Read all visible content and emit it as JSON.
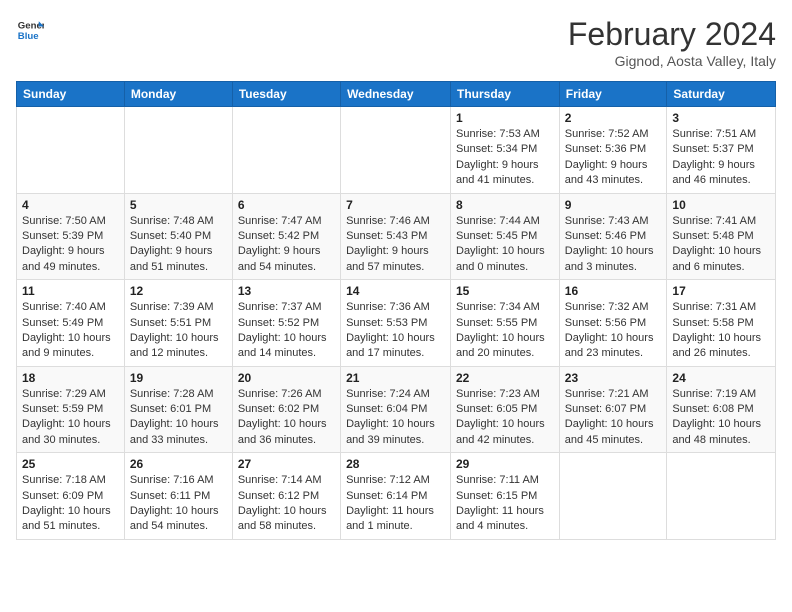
{
  "header": {
    "logo_line1": "General",
    "logo_line2": "Blue",
    "title": "February 2024",
    "subtitle": "Gignod, Aosta Valley, Italy"
  },
  "days_of_week": [
    "Sunday",
    "Monday",
    "Tuesday",
    "Wednesday",
    "Thursday",
    "Friday",
    "Saturday"
  ],
  "weeks": [
    [
      {
        "day": "",
        "info": ""
      },
      {
        "day": "",
        "info": ""
      },
      {
        "day": "",
        "info": ""
      },
      {
        "day": "",
        "info": ""
      },
      {
        "day": "1",
        "info": "Sunrise: 7:53 AM\nSunset: 5:34 PM\nDaylight: 9 hours\nand 41 minutes."
      },
      {
        "day": "2",
        "info": "Sunrise: 7:52 AM\nSunset: 5:36 PM\nDaylight: 9 hours\nand 43 minutes."
      },
      {
        "day": "3",
        "info": "Sunrise: 7:51 AM\nSunset: 5:37 PM\nDaylight: 9 hours\nand 46 minutes."
      }
    ],
    [
      {
        "day": "4",
        "info": "Sunrise: 7:50 AM\nSunset: 5:39 PM\nDaylight: 9 hours\nand 49 minutes."
      },
      {
        "day": "5",
        "info": "Sunrise: 7:48 AM\nSunset: 5:40 PM\nDaylight: 9 hours\nand 51 minutes."
      },
      {
        "day": "6",
        "info": "Sunrise: 7:47 AM\nSunset: 5:42 PM\nDaylight: 9 hours\nand 54 minutes."
      },
      {
        "day": "7",
        "info": "Sunrise: 7:46 AM\nSunset: 5:43 PM\nDaylight: 9 hours\nand 57 minutes."
      },
      {
        "day": "8",
        "info": "Sunrise: 7:44 AM\nSunset: 5:45 PM\nDaylight: 10 hours\nand 0 minutes."
      },
      {
        "day": "9",
        "info": "Sunrise: 7:43 AM\nSunset: 5:46 PM\nDaylight: 10 hours\nand 3 minutes."
      },
      {
        "day": "10",
        "info": "Sunrise: 7:41 AM\nSunset: 5:48 PM\nDaylight: 10 hours\nand 6 minutes."
      }
    ],
    [
      {
        "day": "11",
        "info": "Sunrise: 7:40 AM\nSunset: 5:49 PM\nDaylight: 10 hours\nand 9 minutes."
      },
      {
        "day": "12",
        "info": "Sunrise: 7:39 AM\nSunset: 5:51 PM\nDaylight: 10 hours\nand 12 minutes."
      },
      {
        "day": "13",
        "info": "Sunrise: 7:37 AM\nSunset: 5:52 PM\nDaylight: 10 hours\nand 14 minutes."
      },
      {
        "day": "14",
        "info": "Sunrise: 7:36 AM\nSunset: 5:53 PM\nDaylight: 10 hours\nand 17 minutes."
      },
      {
        "day": "15",
        "info": "Sunrise: 7:34 AM\nSunset: 5:55 PM\nDaylight: 10 hours\nand 20 minutes."
      },
      {
        "day": "16",
        "info": "Sunrise: 7:32 AM\nSunset: 5:56 PM\nDaylight: 10 hours\nand 23 minutes."
      },
      {
        "day": "17",
        "info": "Sunrise: 7:31 AM\nSunset: 5:58 PM\nDaylight: 10 hours\nand 26 minutes."
      }
    ],
    [
      {
        "day": "18",
        "info": "Sunrise: 7:29 AM\nSunset: 5:59 PM\nDaylight: 10 hours\nand 30 minutes."
      },
      {
        "day": "19",
        "info": "Sunrise: 7:28 AM\nSunset: 6:01 PM\nDaylight: 10 hours\nand 33 minutes."
      },
      {
        "day": "20",
        "info": "Sunrise: 7:26 AM\nSunset: 6:02 PM\nDaylight: 10 hours\nand 36 minutes."
      },
      {
        "day": "21",
        "info": "Sunrise: 7:24 AM\nSunset: 6:04 PM\nDaylight: 10 hours\nand 39 minutes."
      },
      {
        "day": "22",
        "info": "Sunrise: 7:23 AM\nSunset: 6:05 PM\nDaylight: 10 hours\nand 42 minutes."
      },
      {
        "day": "23",
        "info": "Sunrise: 7:21 AM\nSunset: 6:07 PM\nDaylight: 10 hours\nand 45 minutes."
      },
      {
        "day": "24",
        "info": "Sunrise: 7:19 AM\nSunset: 6:08 PM\nDaylight: 10 hours\nand 48 minutes."
      }
    ],
    [
      {
        "day": "25",
        "info": "Sunrise: 7:18 AM\nSunset: 6:09 PM\nDaylight: 10 hours\nand 51 minutes."
      },
      {
        "day": "26",
        "info": "Sunrise: 7:16 AM\nSunset: 6:11 PM\nDaylight: 10 hours\nand 54 minutes."
      },
      {
        "day": "27",
        "info": "Sunrise: 7:14 AM\nSunset: 6:12 PM\nDaylight: 10 hours\nand 58 minutes."
      },
      {
        "day": "28",
        "info": "Sunrise: 7:12 AM\nSunset: 6:14 PM\nDaylight: 11 hours\nand 1 minute."
      },
      {
        "day": "29",
        "info": "Sunrise: 7:11 AM\nSunset: 6:15 PM\nDaylight: 11 hours\nand 4 minutes."
      },
      {
        "day": "",
        "info": ""
      },
      {
        "day": "",
        "info": ""
      }
    ]
  ]
}
